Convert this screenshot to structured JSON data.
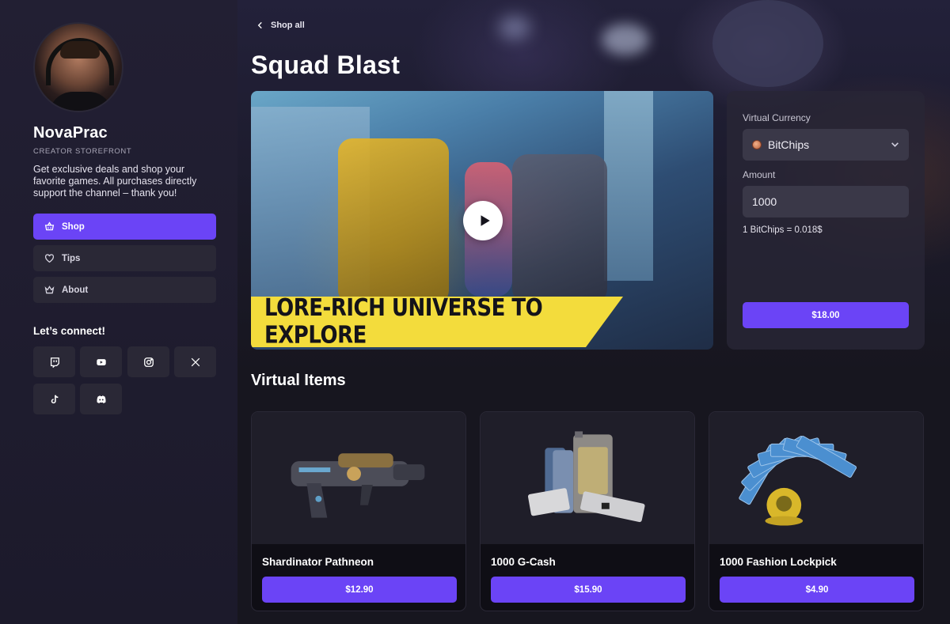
{
  "colors": {
    "accent": "#6b44f6",
    "background": "#17161f",
    "sidebar": "#221f33",
    "card": "#2a2836"
  },
  "creator": {
    "name": "NovaPrac",
    "subtitle": "CREATOR STOREFRONT",
    "description": "Get exclusive deals and shop your favorite games. All purchases directly support the channel – thank you!"
  },
  "nav": [
    {
      "label": "Shop",
      "icon": "shop-basket-icon",
      "active": true
    },
    {
      "label": "Tips",
      "icon": "heart-icon",
      "active": false
    },
    {
      "label": "About",
      "icon": "crown-icon",
      "active": false
    }
  ],
  "connect": {
    "title": "Let’s connect!",
    "socials": [
      "twitch-icon",
      "youtube-icon",
      "instagram-icon",
      "x-icon",
      "tiktok-icon",
      "discord-icon"
    ]
  },
  "main": {
    "back_label": "Shop all",
    "title": "Squad Blast",
    "video_banner": "LORE-RICH UNIVERSE TO EXPLORE"
  },
  "currency_panel": {
    "currency_label": "Virtual Currency",
    "selected_currency": "BitChips",
    "amount_label": "Amount",
    "amount_value": "1000",
    "rate": "1 BitChips = 0.018$",
    "buy_label": "$18.00"
  },
  "virtual_items": {
    "title": "Virtual Items",
    "items": [
      {
        "name": "Shardinator Pathneon",
        "price": "$12.90",
        "image": "blaster-gun-image"
      },
      {
        "name": "1000 G-Cash",
        "price": "$15.90",
        "image": "g-cash-cards-image"
      },
      {
        "name": "1000 Fashion Lockpick",
        "price": "$4.90",
        "image": "lockpick-tickets-image"
      }
    ]
  }
}
